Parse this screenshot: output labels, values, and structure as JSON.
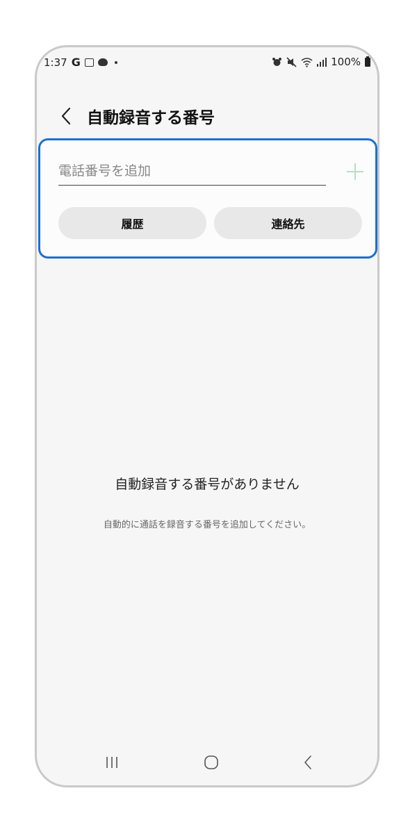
{
  "status_bar": {
    "time": "1:37",
    "g_label": "G",
    "battery": "100%"
  },
  "header": {
    "title": "自動録音する番号"
  },
  "add_number": {
    "placeholder": "電話番号を追加",
    "history_label": "履歴",
    "contacts_label": "連絡先"
  },
  "empty_state": {
    "title": "自動録音する番号がありません",
    "subtitle": "自動的に通話を録音する番号を追加してください。"
  },
  "colors": {
    "accent_border": "#1a6fd6",
    "add_icon": "#b9dcc4",
    "background": "#f6f6f6"
  },
  "icons": {
    "back": "chevron-left-icon",
    "add": "plus-icon",
    "nav_recents": "recents-icon",
    "nav_home": "home-icon",
    "nav_back": "back-icon"
  }
}
